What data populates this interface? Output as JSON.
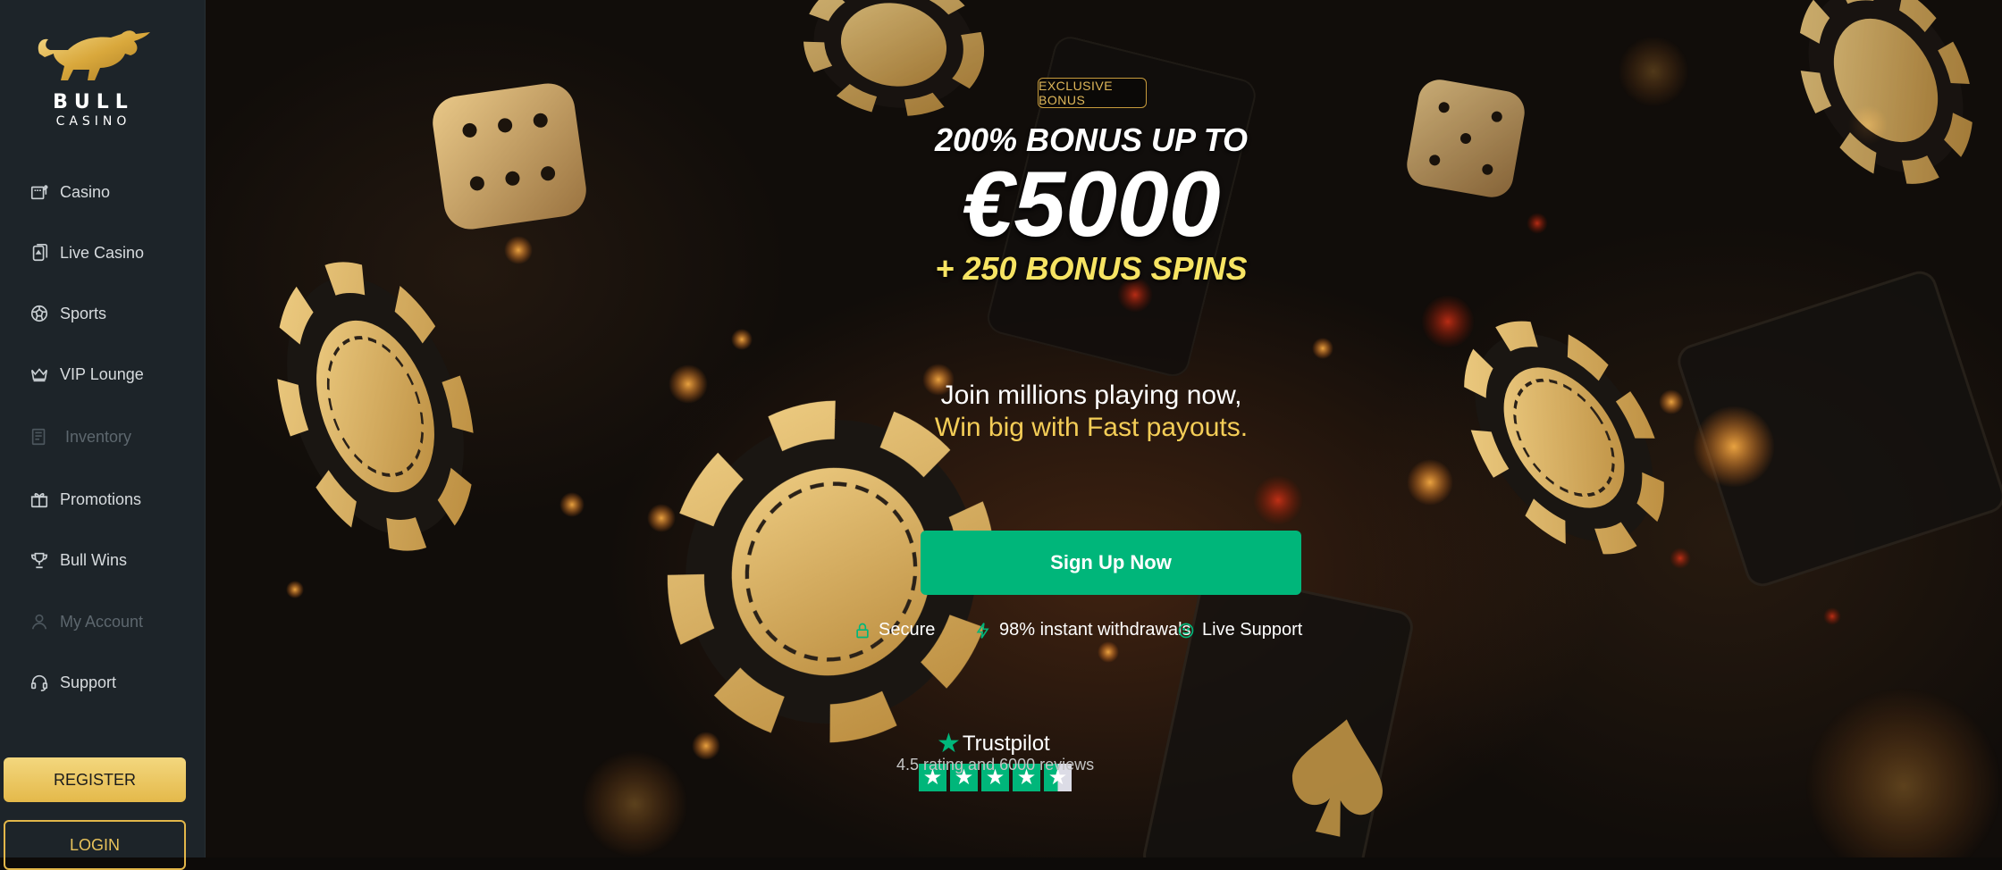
{
  "brand": {
    "line1": "BULL",
    "line2": "CASINO"
  },
  "sidebar": {
    "items": [
      {
        "label": "Casino",
        "icon": "slot-machine-icon",
        "disabled": false
      },
      {
        "label": "Live Casino",
        "icon": "cards-icon",
        "disabled": false
      },
      {
        "label": "Sports",
        "icon": "soccer-ball-icon",
        "disabled": false
      },
      {
        "label": "VIP Lounge",
        "icon": "crown-icon",
        "disabled": false
      },
      {
        "label": "Inventory",
        "icon": "inventory-icon",
        "disabled": true
      },
      {
        "label": "Promotions",
        "icon": "gift-icon",
        "disabled": false
      },
      {
        "label": "Bull Wins",
        "icon": "trophy-icon",
        "disabled": false
      },
      {
        "label": "My Account",
        "icon": "user-icon",
        "disabled": true
      },
      {
        "label": "Support",
        "icon": "headset-icon",
        "disabled": false
      }
    ],
    "register_label": "REGISTER",
    "login_label": "LOGIN"
  },
  "hero": {
    "badge": "EXCLUSIVE BONUS",
    "headline1": "200% BONUS UP TO",
    "headline2": "€5000",
    "headline3": "+ 250 BONUS SPINS",
    "subline1": "Join millions playing now,",
    "subline2": "Win big with Fast payouts.",
    "cta_label": "Sign Up Now",
    "features": [
      {
        "label": "Secure",
        "icon": "lock-icon"
      },
      {
        "label": "98% instant withdrawals",
        "icon": "lightning-icon"
      },
      {
        "label": "Live Support",
        "icon": "smiley-icon"
      }
    ]
  },
  "trustpilot": {
    "name": "Trustpilot",
    "rating_text": "4.5 rating and 6000 reviews",
    "stars": 4.5
  },
  "colors": {
    "sidebar_bg": "#1d2429",
    "gold": "#e4b94a",
    "green": "#00b67a",
    "yellow_text": "#f7e463"
  }
}
